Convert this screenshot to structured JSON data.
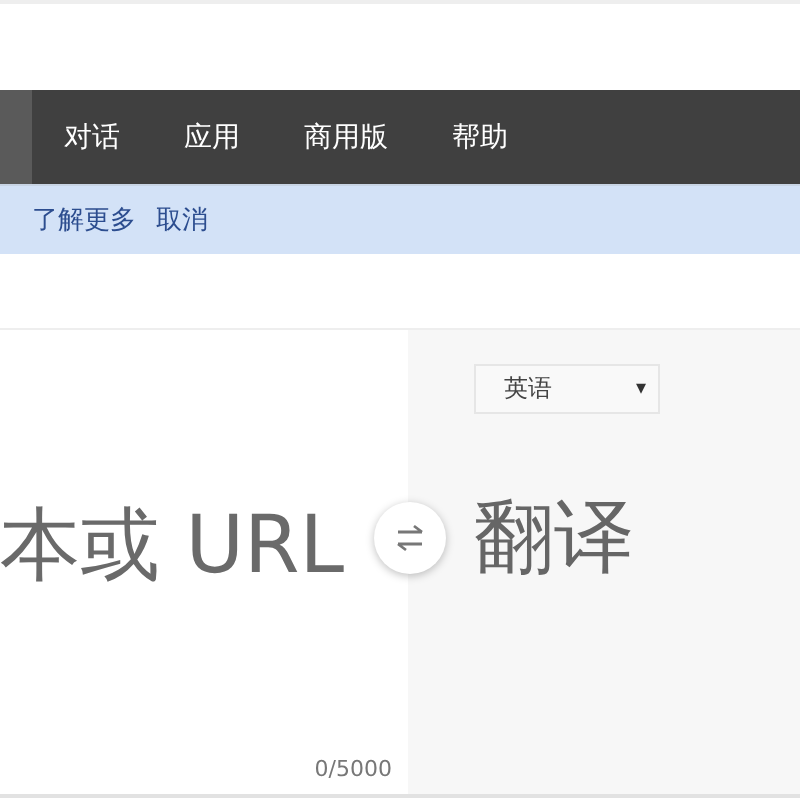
{
  "nav": {
    "items": [
      {
        "label": "对话"
      },
      {
        "label": "应用"
      },
      {
        "label": "商用版"
      },
      {
        "label": "帮助"
      }
    ]
  },
  "notice": {
    "links": [
      "了解更多",
      "取消"
    ]
  },
  "source": {
    "placeholder": "本或 URL",
    "counter": "0/5000"
  },
  "target": {
    "language": "英语",
    "caret": "▾",
    "output": "翻译"
  }
}
